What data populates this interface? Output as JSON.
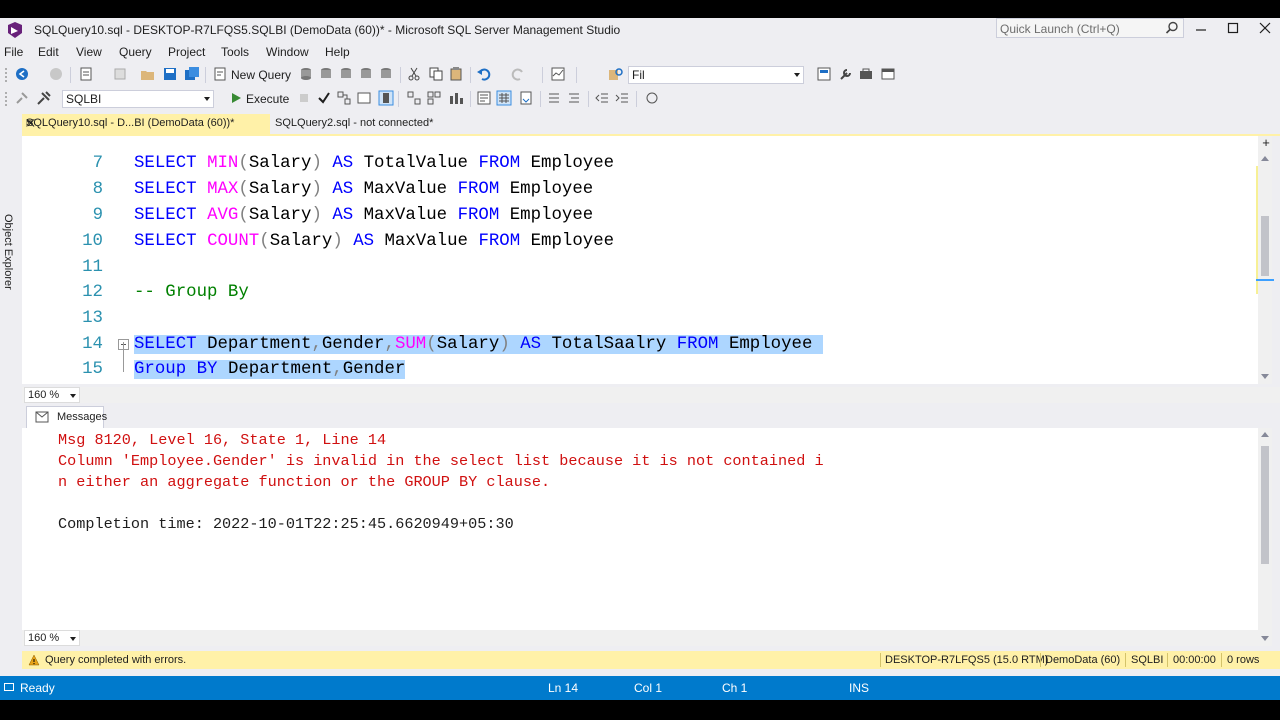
{
  "window": {
    "title": "SQLQuery10.sql - DESKTOP-R7LFQS5.SQLBI (DemoData (60))* - Microsoft SQL Server Management Studio",
    "quick_launch_placeholder": "Quick Launch (Ctrl+Q)"
  },
  "menu": [
    "File",
    "Edit",
    "View",
    "Query",
    "Project",
    "Tools",
    "Window",
    "Help"
  ],
  "toolbar": {
    "new_query_label": "New Query",
    "find_value": "Fil",
    "database_value": "SQLBI",
    "execute_label": "Execute"
  },
  "side_panel": {
    "label": "Object Explorer"
  },
  "tabs": {
    "active_label": "SQLQuery10.sql - D...BI (DemoData (60))*",
    "inactive_label": "SQLQuery2.sql - not connected*"
  },
  "editor": {
    "line_numbers": [
      "7",
      "8",
      "9",
      "10",
      "11",
      "12",
      "13",
      "14",
      "15"
    ],
    "zoom": "160 %"
  },
  "messages": {
    "tab_label": "Messages",
    "lines": [
      "Msg 8120, Level 16, State 1, Line 14",
      "Column 'Employee.Gender' is invalid in the select list because it is not contained i",
      "n either an aggregate function or the GROUP BY clause.",
      "Completion time: 2022-10-01T22:25:45.6620949+05:30"
    ],
    "zoom": "160 %"
  },
  "query_status": {
    "text": "Query completed with errors.",
    "server": "DESKTOP-R7LFQS5 (15.0 RTM)",
    "database": "DemoData (60)",
    "user": "SQLBI",
    "elapsed": "00:00:00",
    "rows": "0 rows"
  },
  "statusbar": {
    "ready": "Ready",
    "ln": "Ln 14",
    "col": "Col 1",
    "ch": "Ch 1",
    "mode": "INS"
  },
  "colors": {
    "accent": "#007acc",
    "selection": "#add6ff",
    "keyword": "#0000ff",
    "function": "#ff00ff",
    "comment": "#008000",
    "error": "#d01010",
    "tab_yellow": "#fff1a8"
  }
}
